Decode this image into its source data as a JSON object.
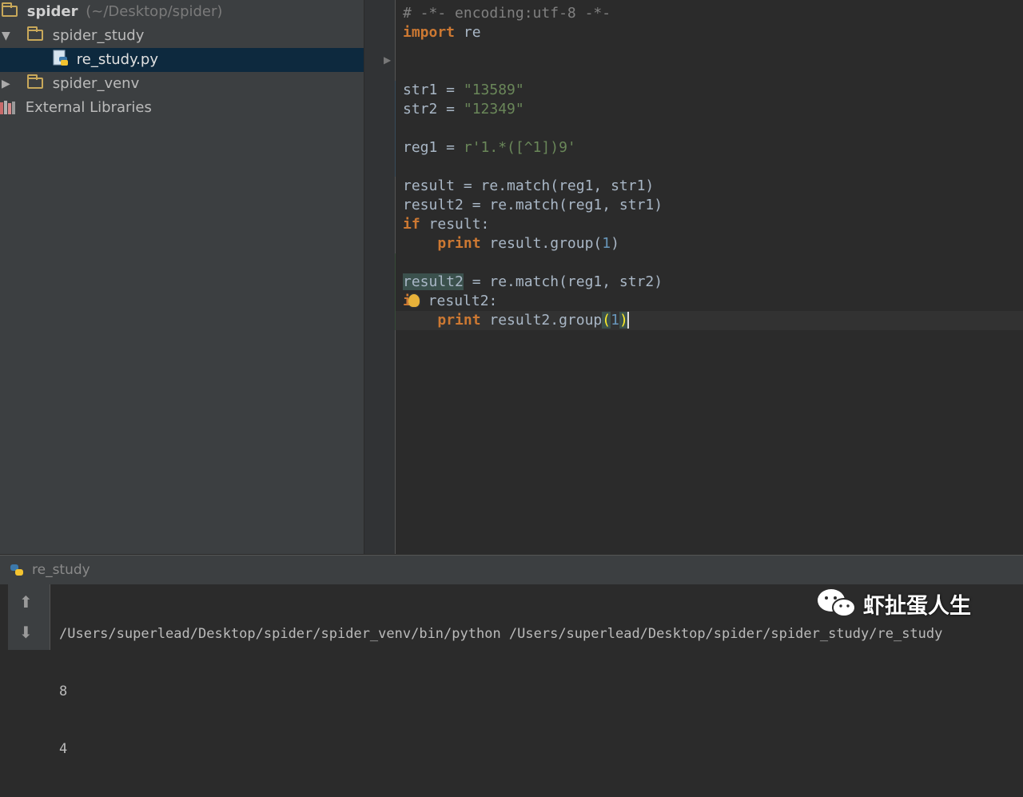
{
  "project": {
    "root_name": "spider",
    "root_path": "(~/Desktop/spider)",
    "items": [
      {
        "label": "spider_study"
      },
      {
        "label": "re_study.py"
      },
      {
        "label": "spider_venv"
      },
      {
        "label": "External Libraries"
      }
    ]
  },
  "editor": {
    "lines": [
      "# -*- encoding:utf-8 -*-",
      "import re",
      "",
      "",
      "str1 = \"13589\"",
      "str2 = \"12349\"",
      "",
      "reg1 = r'1.*([^1])9'",
      "",
      "result = re.match(reg1, str1)",
      "result2 = re.match(reg1, str1)",
      "if result:",
      "    print result.group(1)",
      "",
      "result2 = re.match(reg1, str2)",
      "if result2:",
      "    print result2.group(1)"
    ]
  },
  "run": {
    "tab_label": "re_study",
    "output": [
      "/Users/superlead/Desktop/spider/spider_venv/bin/python /Users/superlead/Desktop/spider/spider_study/re_study",
      "8",
      "4"
    ]
  },
  "watermark": {
    "text": "虾扯蛋人生"
  },
  "colors": {
    "keyword": "#cc7832",
    "string": "#6a8759",
    "comment": "#808080",
    "number": "#6897bb",
    "selection": "#0d293e"
  }
}
